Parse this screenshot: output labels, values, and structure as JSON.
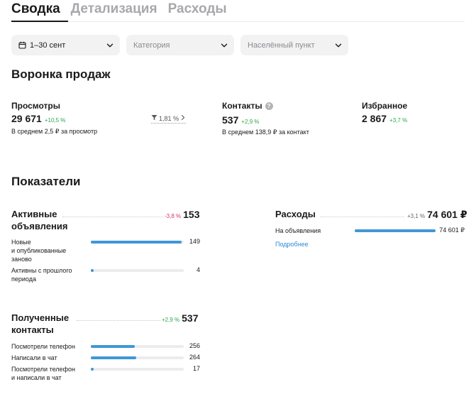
{
  "tabs": [
    {
      "label": "Сводка",
      "active": true
    },
    {
      "label": "Детализация",
      "active": false
    },
    {
      "label": "Расходы",
      "active": false
    }
  ],
  "filters": {
    "period": "1–30 сент",
    "category_placeholder": "Категория",
    "location_placeholder": "Населённый пункт"
  },
  "funnel": {
    "title": "Воронка продаж",
    "views": {
      "label": "Просмотры",
      "value": "29 671",
      "delta": "+10,5 %",
      "sub": "В среднем 2,5 ₽ за просмотр",
      "conversion": "1,81 %"
    },
    "contacts": {
      "label": "Контакты",
      "value": "537",
      "delta": "+2,9 %",
      "sub": "В среднем 138,9 ₽ за контакт"
    },
    "favorites": {
      "label": "Избранное",
      "value": "2 867",
      "delta": "+3,7 %"
    }
  },
  "indicators": {
    "title": "Показатели",
    "active_ads": {
      "title_line1": "Активные",
      "title_line2": "объявления",
      "delta": "-3,8 %",
      "total": "153",
      "rows": [
        {
          "label_lines": [
            "Новые",
            "и опубликованные",
            "заново"
          ],
          "value": "149",
          "fraction": 0.974
        },
        {
          "label_lines": [
            "Активны с прошлого",
            "периода"
          ],
          "value": "4",
          "fraction": 0.026
        }
      ]
    },
    "contacts": {
      "title_line1": "Полученные",
      "title_line2": "контакты",
      "delta": "+2,9 %",
      "total": "537",
      "rows": [
        {
          "label_lines": [
            "Посмотрели телефон"
          ],
          "value": "256",
          "fraction": 0.477
        },
        {
          "label_lines": [
            "Написали в чат"
          ],
          "value": "264",
          "fraction": 0.492
        },
        {
          "label_lines": [
            "Посмотрели телефон",
            "и написали в чат"
          ],
          "value": "17",
          "fraction": 0.032
        }
      ]
    },
    "expenses": {
      "title": "Расходы",
      "delta": "+3,1 %",
      "total": "74 601 ₽",
      "rows": [
        {
          "label": "На объявления",
          "value": "74 601 ₽",
          "fraction": 1.0
        }
      ],
      "more_link": "Подробнее"
    }
  },
  "colors": {
    "accent": "#3f97d6",
    "positive": "#2aa84a",
    "negative": "#d8345f"
  },
  "icons": {
    "calendar": "calendar-icon",
    "chevron": "chevron-down-icon",
    "help": "question-icon",
    "funnel": "funnel-icon",
    "arrow": "chevron-right-icon"
  }
}
